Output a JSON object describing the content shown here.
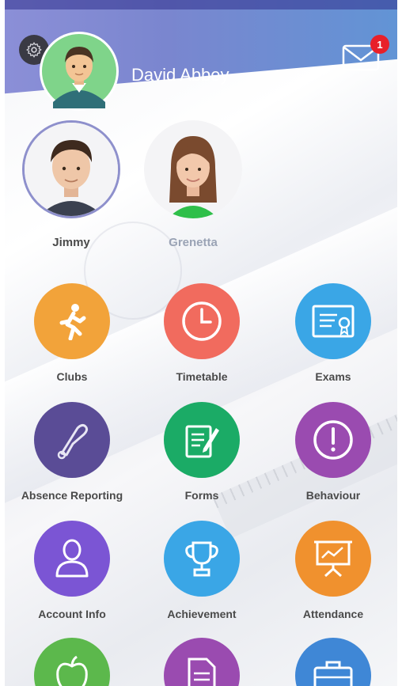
{
  "header": {
    "parent_name": "David Abbey",
    "unread_count": "1",
    "settings_icon": "gear-icon",
    "mail_icon": "envelope-icon"
  },
  "children": [
    {
      "name": "Jimmy",
      "selected": true
    },
    {
      "name": "Grenetta",
      "selected": false
    }
  ],
  "menu": [
    {
      "label": "Clubs",
      "icon": "running-person-icon",
      "color": "#f2a33a"
    },
    {
      "label": "Timetable",
      "icon": "clock-icon",
      "color": "#f16b5e"
    },
    {
      "label": "Exams",
      "icon": "certificate-icon",
      "color": "#3aa6e6"
    },
    {
      "label": "Absence Reporting",
      "icon": "bell-icon",
      "color": "#5a4c96"
    },
    {
      "label": "Forms",
      "icon": "form-icon",
      "color": "#1bab66"
    },
    {
      "label": "Behaviour",
      "icon": "exclamation-icon",
      "color": "#9a4bb0"
    },
    {
      "label": "Account Info",
      "icon": "person-icon",
      "color": "#7b55d4"
    },
    {
      "label": "Achievement",
      "icon": "trophy-icon",
      "color": "#3aa6e6"
    },
    {
      "label": "Attendance",
      "icon": "presentation-chart-icon",
      "color": "#f0912e"
    },
    {
      "label": "",
      "icon": "apple-icon",
      "color": "#5cb84c"
    },
    {
      "label": "",
      "icon": "document-icon",
      "color": "#9a4bb0"
    },
    {
      "label": "",
      "icon": "briefcase-icon",
      "color": "#3f87d6"
    }
  ]
}
